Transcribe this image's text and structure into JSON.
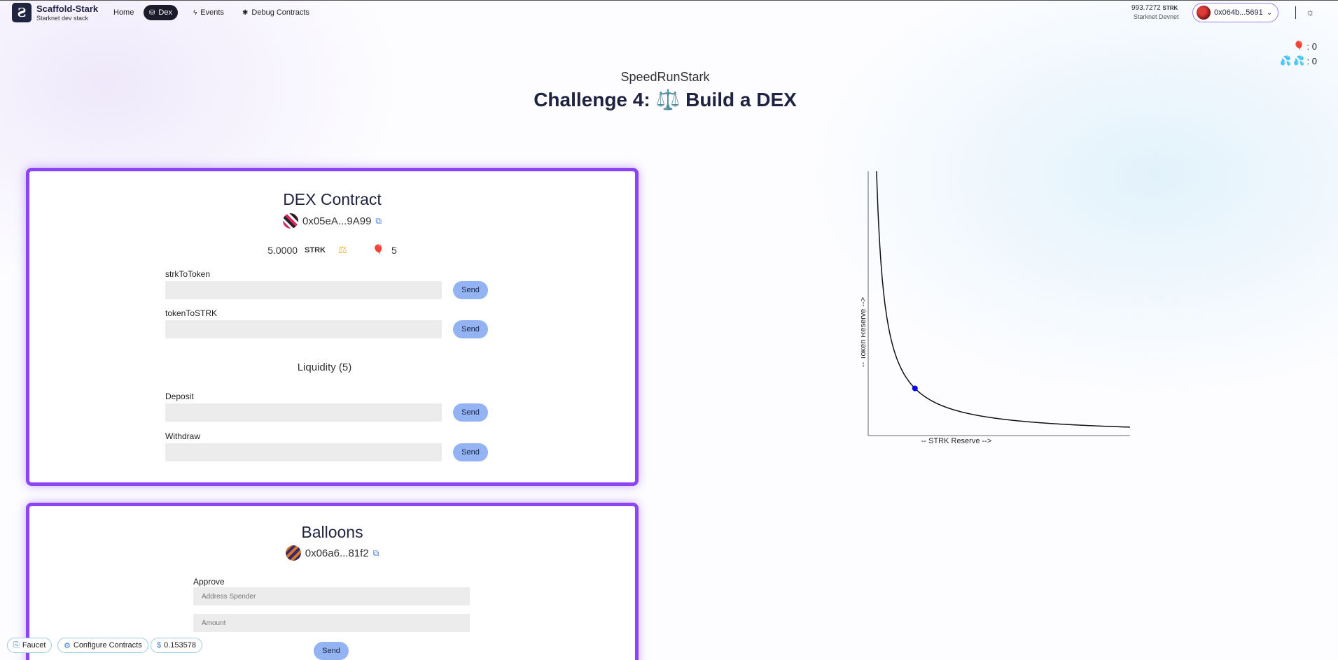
{
  "brand": {
    "title": "Scaffold-Stark",
    "subtitle": "Starknet dev stack",
    "logo_icon": "scaffold-logo"
  },
  "nav": [
    {
      "label": "Home",
      "icon": "",
      "active": false
    },
    {
      "label": "Dex",
      "icon": "database-icon",
      "active": true
    },
    {
      "label": "Events",
      "icon": "bolt-icon",
      "active": false
    },
    {
      "label": "Debug Contracts",
      "icon": "bug-icon",
      "active": false
    }
  ],
  "account": {
    "balance": "993.7272",
    "currency": "STRK",
    "network": "Starknet Devnet",
    "address": "0x064b...5691"
  },
  "counters": {
    "balloons": ": 0",
    "strk": ": 0"
  },
  "page": {
    "subtitle": "SpeedRunStark",
    "title_prefix": "Challenge 4:",
    "title_emoji": "⚖️",
    "title_suffix": "Build a DEX"
  },
  "dex": {
    "title": "DEX Contract",
    "address": "0x05eA...9A99",
    "strk_balance": "5.0000",
    "strk_unit": "STRK",
    "balloon_balance": "5",
    "fields": [
      {
        "label": "strkToToken",
        "placeholder": "",
        "button": "Send"
      },
      {
        "label": "tokenToSTRK",
        "placeholder": "",
        "button": "Send"
      }
    ],
    "liquidity_title": "Liquidity (5)",
    "liquidity_fields": [
      {
        "label": "Deposit",
        "placeholder": "",
        "button": "Send"
      },
      {
        "label": "Withdraw",
        "placeholder": "",
        "button": "Send"
      }
    ]
  },
  "balloons": {
    "title": "Balloons",
    "address": "0x06a6...81f2",
    "approve_label": "Approve",
    "spender_placeholder": "Address Spender",
    "amount_placeholder": "Amount",
    "button": "Send"
  },
  "footer": {
    "faucet": "Faucet",
    "configure": "Configure Contracts",
    "price": "0.153578"
  },
  "chart_data": {
    "type": "line",
    "title": "",
    "xlabel": "-- STRK Reserve -->",
    "ylabel": "-- Token Reserve -->",
    "curve": "constant product x*y=k",
    "current_point": {
      "x": 5,
      "y": 5
    },
    "point_color": "#0000ff"
  }
}
